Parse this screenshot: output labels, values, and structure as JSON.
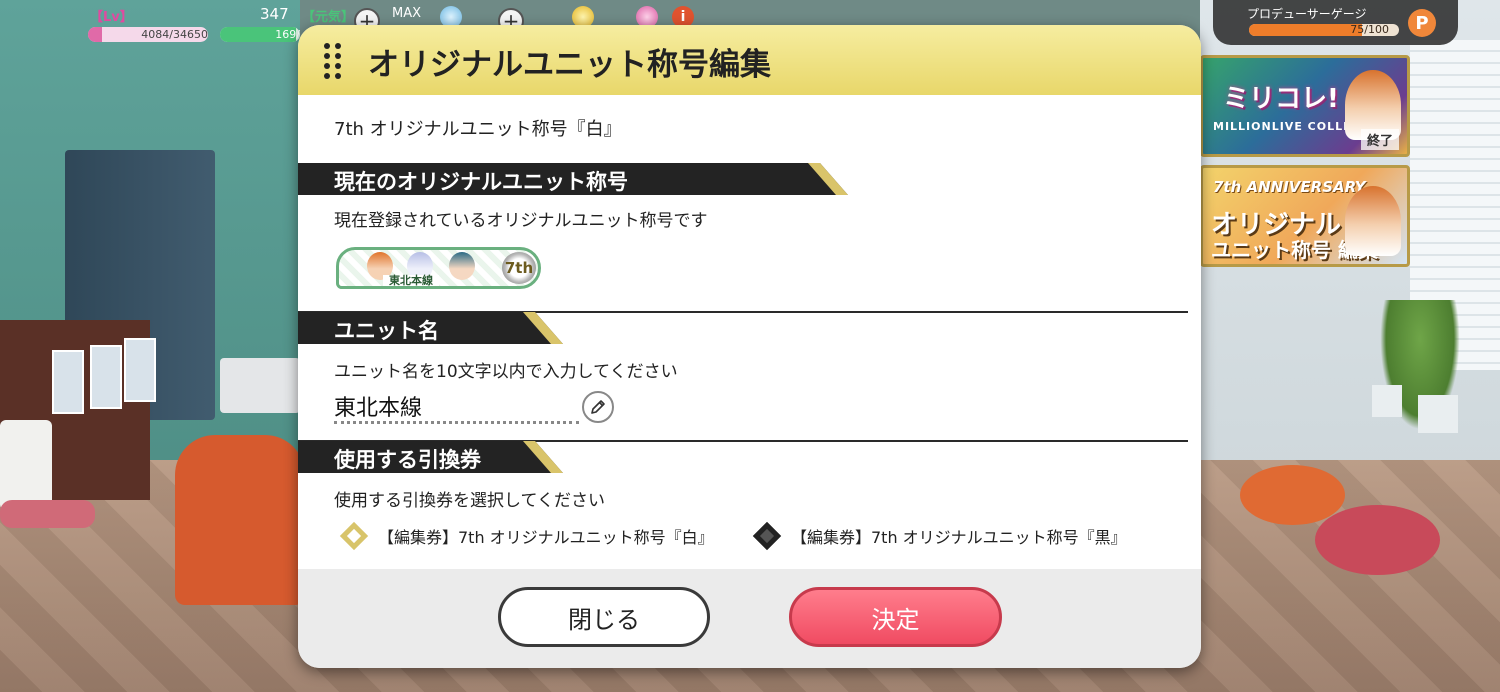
{
  "hud": {
    "lv_label": "【Lv】",
    "lv_value": "347",
    "genki_label": "【元気】",
    "max_label": "MAX",
    "xp_text": "4084/34650",
    "xp_fraction": 0.118,
    "stamina_text": "169/",
    "stamina_fraction": 0.95,
    "plus_icon": "+",
    "info_icon": "i"
  },
  "producer_gauge": {
    "label": "プロデューサーゲージ",
    "value_text": "75/100",
    "fraction": 0.75,
    "icon_letter": "P"
  },
  "banners": {
    "banner1": {
      "title": "ミリコレ!",
      "subtitle": "MILLIONLIVE COLLECTION",
      "status": "終了"
    },
    "banner2": {
      "top": "7th ANNIVERSARY",
      "mid": "オリジナル",
      "bottom": "ユニット称号 編集"
    }
  },
  "dialog": {
    "title": "オリジナルユニット称号編集",
    "subtitle": "7th オリジナルユニット称号『白』",
    "current_section": {
      "heading": "現在のオリジナルユニット称号",
      "description": "現在登録されているオリジナルユニット称号です",
      "plate_name": "東北本線",
      "emblem_text": "7th"
    },
    "unit_name_section": {
      "heading": "ユニット名",
      "description": "ユニット名を10文字以内で入力してください",
      "value": "東北本線"
    },
    "ticket_section": {
      "heading": "使用する引換券",
      "description": "使用する引換券を選択してください",
      "options": [
        {
          "label": "【編集券】7th オリジナルユニット称号『白』",
          "color": "#d8c46a"
        },
        {
          "label": "【編集券】7th オリジナルユニット称号『黒』",
          "color": "#333333"
        }
      ]
    },
    "buttons": {
      "close": "閉じる",
      "confirm": "決定"
    }
  },
  "colors": {
    "header_gold": "#e8d76a",
    "section_black": "#232323",
    "confirm_pink": "#f04b62"
  }
}
